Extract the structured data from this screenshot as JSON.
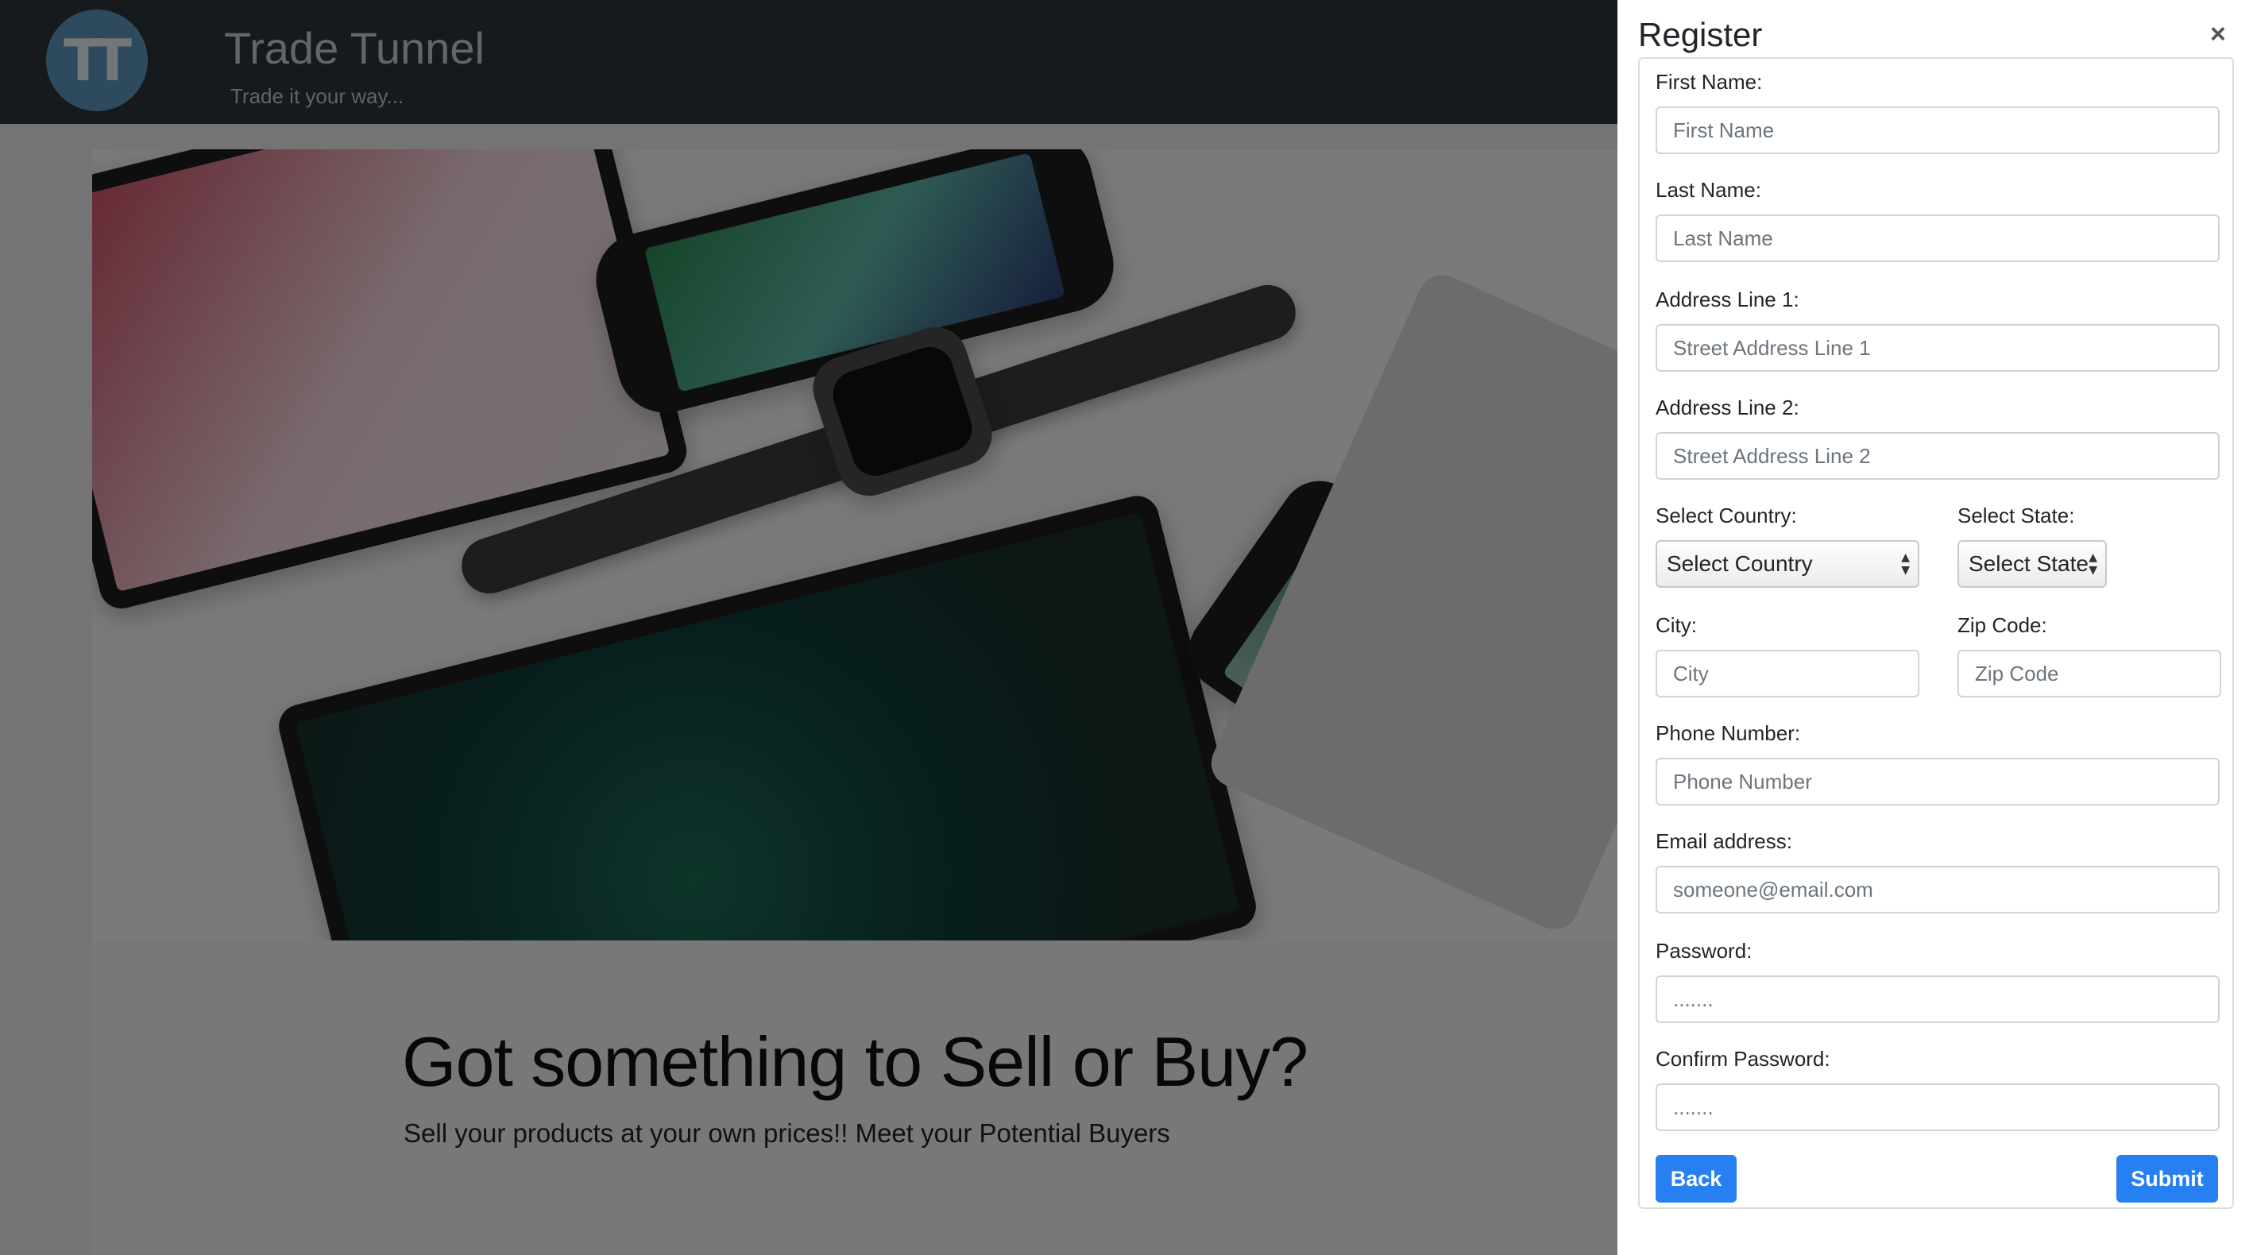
{
  "header": {
    "logo_text": "TT",
    "title": "Trade Tunnel",
    "tagline": "Trade it your way..."
  },
  "hero": {
    "headline": "Got something to Sell or Buy?",
    "subline": "Sell your products at your own prices!! Meet your Potential Buyers"
  },
  "register": {
    "title": "Register",
    "close_glyph": "×",
    "first_name": {
      "label": "First Name:",
      "placeholder": "First Name"
    },
    "last_name": {
      "label": "Last Name:",
      "placeholder": "Last Name"
    },
    "address1": {
      "label": "Address Line 1:",
      "placeholder": "Street Address Line 1"
    },
    "address2": {
      "label": "Address Line 2:",
      "placeholder": "Street Address Line 2"
    },
    "country": {
      "label": "Select Country:",
      "value": "Select Country"
    },
    "state": {
      "label": "Select State:",
      "value": "Select State"
    },
    "city": {
      "label": "City:",
      "placeholder": "City"
    },
    "zip": {
      "label": "Zip Code:",
      "placeholder": "Zip Code"
    },
    "phone": {
      "label": "Phone Number:",
      "placeholder": "Phone Number"
    },
    "email": {
      "label": "Email address:",
      "placeholder": "someone@email.com"
    },
    "password": {
      "label": "Password:",
      "placeholder": "......."
    },
    "confirm_password": {
      "label": "Confirm Password:",
      "placeholder": "......."
    },
    "back_label": "Back",
    "submit_label": "Submit"
  },
  "colors": {
    "header_bg": "#2f343b",
    "logo_bg": "#5b95bd",
    "button_primary": "#2680f2"
  }
}
